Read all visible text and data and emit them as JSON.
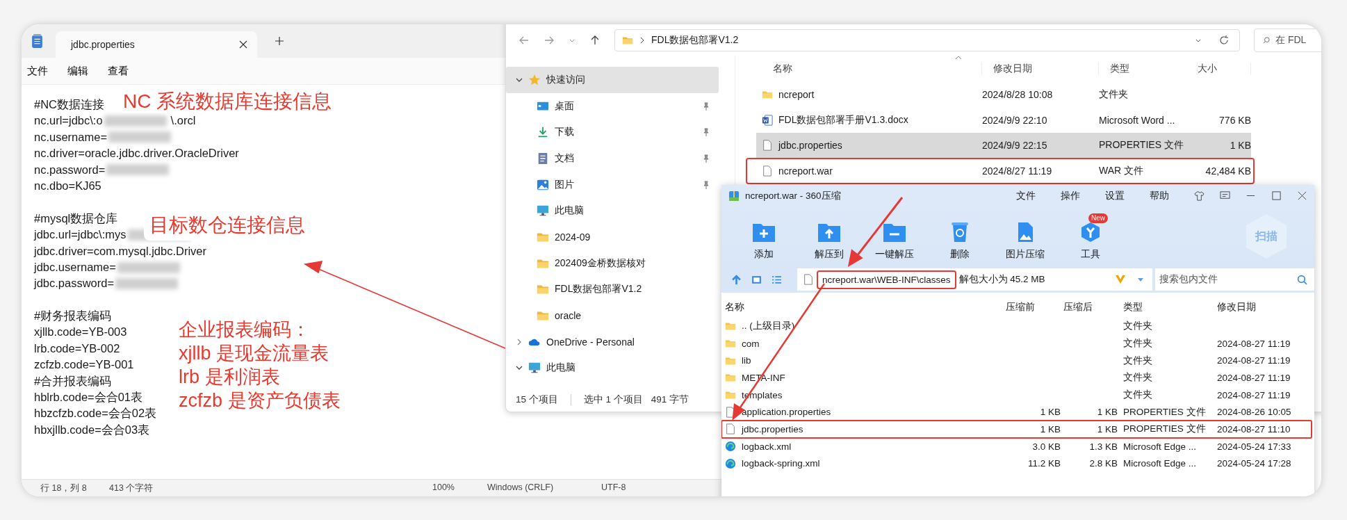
{
  "notepad": {
    "tab_title": "jdbc.properties",
    "menu": [
      "文件",
      "编辑",
      "查看"
    ],
    "blocks": [
      [
        {
          "text": "#NC数据连接"
        },
        {
          "text": "nc.url=jdbc\\:o",
          "redacted": true,
          "suffix": "\\.orcl"
        },
        {
          "text": "nc.username=",
          "redacted": true
        },
        {
          "text": "nc.driver=oracle.jdbc.driver.OracleDriver"
        },
        {
          "text": "nc.password=",
          "redacted": true
        },
        {
          "text": "nc.dbo=KJ65"
        }
      ],
      [
        {
          "text": "#mysql数据仓库"
        },
        {
          "text": "jdbc.url=jdbc\\:mys",
          "redacted": true
        },
        {
          "text": "jdbc.driver=com.mysql.jdbc.Driver"
        },
        {
          "text": "jdbc.username=",
          "redacted": true
        },
        {
          "text": "jdbc.password=",
          "redacted": true
        }
      ],
      [
        {
          "text": "#财务报表编码"
        },
        {
          "text": "xjllb.code=YB-003"
        },
        {
          "text": "lrb.code=YB-002"
        },
        {
          "text": "zcfzb.code=YB-001"
        },
        {
          "text": "#合并报表编码"
        },
        {
          "text": "hblrb.code=会合01表"
        },
        {
          "text": "hbzcfzb.code=会合02表"
        },
        {
          "text": "hbxjllb.code=会合03表"
        }
      ]
    ],
    "status": [
      "行 18，列 8",
      "413 个字符",
      "100%",
      "Windows (CRLF)",
      "UTF-8"
    ]
  },
  "annotations": [
    {
      "lines": [
        "NC 系统数据库连接信息"
      ]
    },
    {
      "lines": [
        "目标数仓连接信息"
      ]
    },
    {
      "lines": [
        "企业报表编码：",
        "xjllb 是现金流量表",
        "lrb 是利润表",
        "zcfzb 是资产负债表"
      ]
    }
  ],
  "explorer": {
    "address": "FDL数据包部署V1.2",
    "search_placeholder": "在 FDL",
    "nav": [
      {
        "label": "快速访问",
        "kind": "star",
        "expanded": true,
        "selected": true,
        "children": [
          {
            "label": "桌面",
            "kind": "desktop",
            "pinned": true,
            "selected": false
          },
          {
            "label": "下载",
            "kind": "download",
            "pinned": true,
            "selected": false
          },
          {
            "label": "文档",
            "kind": "document",
            "pinned": true,
            "selected": false
          },
          {
            "label": "图片",
            "kind": "picture",
            "pinned": true,
            "selected": false
          },
          {
            "label": "此电脑",
            "kind": "computer",
            "pinned": false,
            "selected": false
          },
          {
            "label": "2024-09",
            "kind": "folder",
            "pinned": false,
            "selected": false
          },
          {
            "label": "202409金桥数据核对",
            "kind": "folder",
            "pinned": false,
            "selected": false
          },
          {
            "label": "FDL数据包部署V1.2",
            "kind": "folder",
            "pinned": false,
            "selected": false
          },
          {
            "label": "oracle",
            "kind": "folder",
            "pinned": false,
            "selected": false
          }
        ]
      },
      {
        "label": "OneDrive - Personal",
        "kind": "cloud",
        "expanded": false,
        "selected": false
      },
      {
        "label": "此电脑",
        "kind": "computer",
        "expanded": true,
        "selected": false
      }
    ],
    "columns": [
      "名称",
      "修改日期",
      "类型",
      "大小"
    ],
    "files": [
      {
        "name": "ncreport",
        "kind": "folder",
        "date": "2024/8/28 10:08",
        "type": "文件夹",
        "selected": false,
        "highlighted": false
      },
      {
        "name": "FDL数据包部署手册V1.3.docx",
        "kind": "word",
        "date": "2024/9/9 22:10",
        "type": "Microsoft Word ...",
        "size": "776 KB",
        "selected": false,
        "highlighted": false
      },
      {
        "name": "jdbc.properties",
        "kind": "file",
        "date": "2024/9/9 22:15",
        "type": "PROPERTIES 文件",
        "size": "1 KB",
        "selected": true,
        "highlighted": false
      },
      {
        "name": "ncreport.war",
        "kind": "file",
        "date": "2024/8/27 11:19",
        "type": "WAR 文件",
        "size": "42,484 KB",
        "selected": false,
        "highlighted": true
      }
    ],
    "status": [
      "15 个项目",
      "选中 1 个项目",
      "491 字节"
    ]
  },
  "zip": {
    "title": "ncreport.war - 360压缩",
    "menu": [
      "文件",
      "操作",
      "设置",
      "帮助"
    ],
    "tools": [
      {
        "label": "添加",
        "kind": "add"
      },
      {
        "label": "解压到",
        "kind": "extract"
      },
      {
        "label": "一键解压",
        "kind": "oneclick"
      },
      {
        "label": "删除",
        "kind": "delete"
      },
      {
        "label": "图片压缩",
        "kind": "image"
      },
      {
        "label": "工具",
        "kind": "tools",
        "badge": "New"
      }
    ],
    "scan": "扫描",
    "path": "ncreport.war\\WEB-INF\\classes",
    "path_highlighted": true,
    "unpack_size": "解包大小为 45.2 MB",
    "search_placeholder": "搜索包内文件",
    "columns": [
      "名称",
      "压缩前",
      "压缩后",
      "类型",
      "修改日期"
    ],
    "rows": [
      {
        "name": ".. (上级目录)",
        "kind": "folder",
        "type": "文件夹",
        "highlighted": false
      },
      {
        "name": "com",
        "kind": "folder",
        "type": "文件夹",
        "date": "2024-08-27 11:19",
        "highlighted": false
      },
      {
        "name": "lib",
        "kind": "folder",
        "type": "文件夹",
        "date": "2024-08-27 11:19",
        "highlighted": false
      },
      {
        "name": "META-INF",
        "kind": "folder",
        "type": "文件夹",
        "date": "2024-08-27 11:19",
        "highlighted": false
      },
      {
        "name": "templates",
        "kind": "folder",
        "type": "文件夹",
        "date": "2024-08-27 11:19",
        "highlighted": false
      },
      {
        "name": "application.properties",
        "kind": "file",
        "before": "1 KB",
        "after": "1 KB",
        "type": "PROPERTIES 文件",
        "date": "2024-08-26 10:05",
        "highlighted": false
      },
      {
        "name": "jdbc.properties",
        "kind": "file",
        "before": "1 KB",
        "after": "1 KB",
        "type": "PROPERTIES 文件",
        "date": "2024-08-27 11:10",
        "highlighted": true
      },
      {
        "name": "logback.xml",
        "kind": "web",
        "before": "3.0 KB",
        "after": "1.3 KB",
        "type": "Microsoft Edge ...",
        "date": "2024-05-24 17:33",
        "highlighted": false
      },
      {
        "name": "logback-spring.xml",
        "kind": "web",
        "before": "11.2 KB",
        "after": "2.8 KB",
        "type": "Microsoft Edge ...",
        "date": "2024-05-24 17:28",
        "highlighted": false
      }
    ]
  }
}
